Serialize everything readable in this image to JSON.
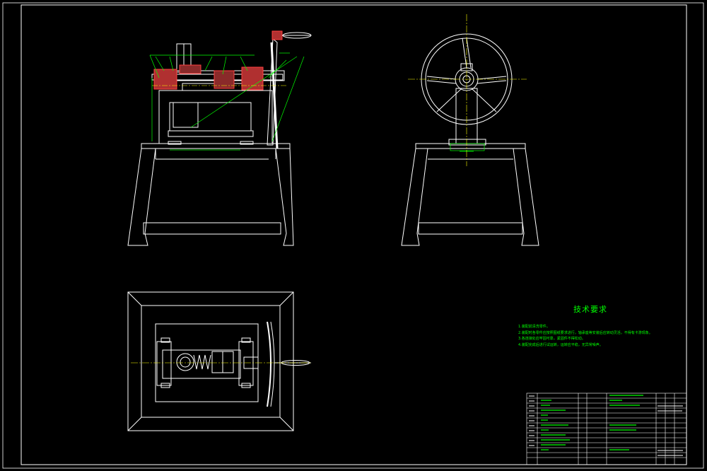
{
  "technical_requirements": {
    "title": "技术要求",
    "items": [
      "1.装配前清洗零件。",
      "2.装配时各零件应按照图纸要求进行，轴承座等安装后应转动灵活，不得有卡滞现象。",
      "3.各连接处应牢固可靠，紧固件不得松动。",
      "4.装配完成后进行试运转，运转应平稳，无异常噪声。"
    ]
  },
  "colors": {
    "background": "#000000",
    "line": "#ffffff",
    "annotation": "#00ff00",
    "section": "#ff4040",
    "centerline": "#ffff00"
  }
}
